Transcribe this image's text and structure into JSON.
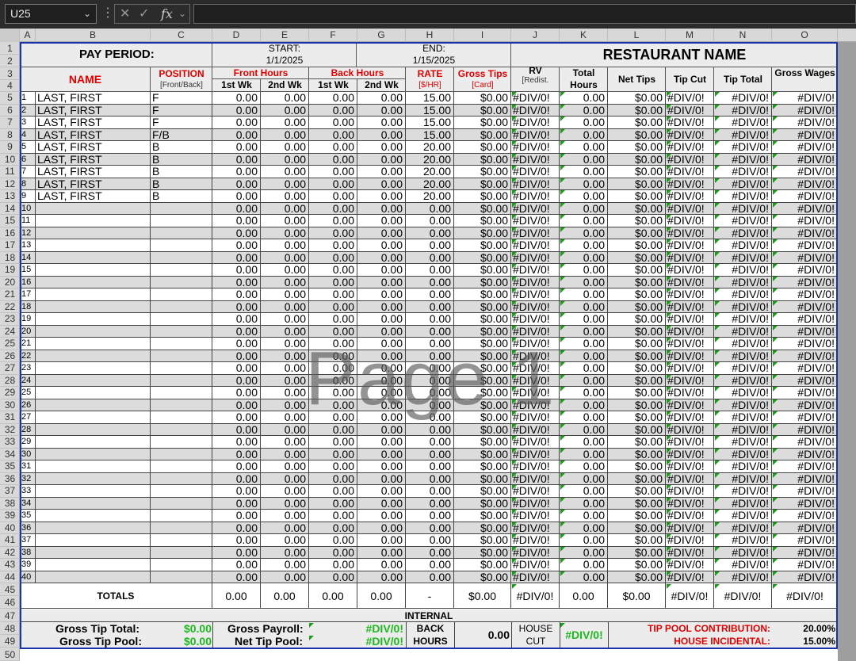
{
  "formula_bar": {
    "cell_ref": "U25",
    "fx": "fx"
  },
  "columns": [
    "A",
    "B",
    "C",
    "D",
    "E",
    "F",
    "G",
    "H",
    "I",
    "J",
    "K",
    "L",
    "M",
    "N",
    "O"
  ],
  "header": {
    "pay_period": "PAY PERIOD:",
    "start_label": "START:",
    "start_date": "1/1/2025",
    "end_label": "END:",
    "end_date": "1/15/2025",
    "restaurant": "RESTAURANT NAME",
    "name": "NAME",
    "position": "POSITION",
    "position_sub": "[Front/Back]",
    "front_hours": "Front Hours",
    "back_hours": "Back Hours",
    "wk1": "1st Wk",
    "wk2": "2nd Wk",
    "rate": "RATE",
    "rate_sub": "[$/HR]",
    "gross_tips": "Gross Tips",
    "gross_tips_sub": "[Card]",
    "rv": "RV",
    "rv_sub": "[Redist.",
    "total_hours": "Total Hours",
    "net_tips": "Net Tips",
    "tip_cut": "Tip Cut",
    "tip_total": "Tip Total",
    "gross_wages": "Gross Wages"
  },
  "employees": [
    {
      "n": "1",
      "name": "LAST, FIRST",
      "pos": "F",
      "rate": "15.00"
    },
    {
      "n": "2",
      "name": "LAST, FIRST",
      "pos": "F",
      "rate": "15.00"
    },
    {
      "n": "3",
      "name": "LAST, FIRST",
      "pos": "F",
      "rate": "15.00"
    },
    {
      "n": "4",
      "name": "LAST, FIRST",
      "pos": "F/B",
      "rate": "15.00"
    },
    {
      "n": "5",
      "name": "LAST, FIRST",
      "pos": "B",
      "rate": "20.00"
    },
    {
      "n": "6",
      "name": "LAST, FIRST",
      "pos": "B",
      "rate": "20.00"
    },
    {
      "n": "7",
      "name": "LAST, FIRST",
      "pos": "B",
      "rate": "20.00"
    },
    {
      "n": "8",
      "name": "LAST, FIRST",
      "pos": "B",
      "rate": "20.00"
    },
    {
      "n": "9",
      "name": "LAST, FIRST",
      "pos": "B",
      "rate": "20.00"
    }
  ],
  "blank_rows": [
    "10",
    "11",
    "12",
    "13",
    "14",
    "15",
    "16",
    "17",
    "18",
    "19",
    "20",
    "21",
    "22",
    "23",
    "24",
    "25",
    "26",
    "27",
    "28",
    "29",
    "30",
    "31",
    "32",
    "33",
    "34",
    "35",
    "36",
    "37",
    "38",
    "39",
    "40"
  ],
  "cell_values": {
    "hours": "0.00",
    "blank_rate": "0.00",
    "tips": "$0.00",
    "div": "#DIV/0!",
    "net": "$0.00"
  },
  "totals": {
    "label": "TOTALS",
    "d": "0.00",
    "e": "0.00",
    "f": "0.00",
    "g": "0.00",
    "h": "-",
    "i": "$0.00",
    "j": "#DIV/0!",
    "k": "0.00",
    "l": "$0.00",
    "m": "#DIV/0!",
    "n": "#DIV/0!",
    "o": "#DIV/0!"
  },
  "footer": {
    "internal": "INTERNAL",
    "gross_tip_total_label": "Gross Tip Total:",
    "gross_tip_total": "$0.00",
    "gross_tip_pool_label": "Gross Tip Pool:",
    "gross_tip_pool": "$0.00",
    "gross_payroll_label": "Gross Payroll:",
    "gross_payroll": "#DIV/0!",
    "net_tip_pool_label": "Net Tip Pool:",
    "net_tip_pool": "#DIV/0!",
    "back_hours_label": "BACK HOURS",
    "back_hours": "0.00",
    "house_cut_label": "HOUSE CUT",
    "house_cut": "#DIV/0!",
    "tip_pool_contribution_label": "TIP POOL CONTRIBUTION:",
    "tip_pool_contribution": "20.00%",
    "house_incidental_label": "HOUSE INCIDENTAL:",
    "house_incidental": "15.00%"
  },
  "watermark": "Page 1",
  "colors": {
    "red": "#e00000",
    "green": "#1fb81f",
    "border": "#1a33a8",
    "alt_row": "#dcdcdc"
  }
}
